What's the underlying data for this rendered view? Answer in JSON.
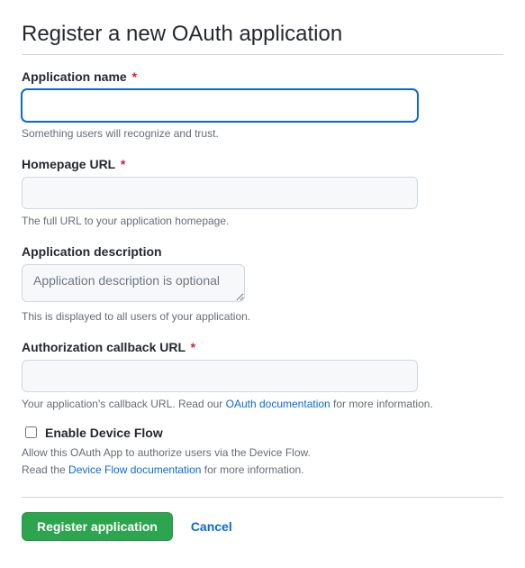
{
  "title": "Register a new OAuth application",
  "fields": {
    "app_name": {
      "label": "Application name",
      "required": true,
      "value": "",
      "hint": "Something users will recognize and trust."
    },
    "homepage_url": {
      "label": "Homepage URL",
      "required": true,
      "value": "",
      "hint": "The full URL to your application homepage."
    },
    "description": {
      "label": "Application description",
      "required": false,
      "value": "",
      "placeholder": "Application description is optional",
      "hint": "This is displayed to all users of your application."
    },
    "callback_url": {
      "label": "Authorization callback URL",
      "required": true,
      "value": "",
      "hint_pre": "Your application's callback URL. Read our ",
      "hint_link": "OAuth documentation",
      "hint_post": " for more information."
    }
  },
  "device_flow": {
    "label": "Enable Device Flow",
    "checked": false,
    "hint_line1": "Allow this OAuth App to authorize users via the Device Flow.",
    "hint_line2_pre": "Read the ",
    "hint_line2_link": "Device Flow documentation",
    "hint_line2_post": " for more information."
  },
  "actions": {
    "submit": "Register application",
    "cancel": "Cancel"
  },
  "required_mark": "*"
}
